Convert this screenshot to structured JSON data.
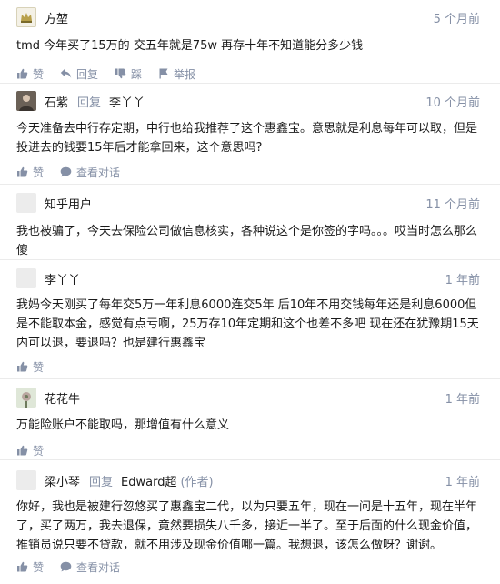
{
  "comments": [
    {
      "author": "方堃",
      "reply_word": "",
      "reply_target": "",
      "role": "",
      "time": "5 个月前",
      "text": "tmd 今年买了15万的 交五年就是75w 再存十年不知道能分多少钱",
      "actions": [
        "赞",
        "回复",
        "踩",
        "举报"
      ]
    },
    {
      "author": "石紫",
      "reply_word": "回复",
      "reply_target": "李丫丫",
      "role": "",
      "time": "10 个月前",
      "text": "今天准备去中行存定期，中行也给我推荐了这个惠鑫宝。意思就是利息每年可以取，但是投进去的钱要15年后才能拿回来，这个意思吗?",
      "actions": [
        "赞",
        "查看对话"
      ]
    },
    {
      "author": "知乎用户",
      "reply_word": "",
      "reply_target": "",
      "role": "",
      "time": "11 个月前",
      "text": "我也被骗了，今天去保险公司做信息核实，各种说这个是你签的字吗。。。哎当时怎么那么傻",
      "actions": []
    },
    {
      "author": "李丫丫",
      "reply_word": "",
      "reply_target": "",
      "role": "",
      "time": "1 年前",
      "text": "我妈今天刚买了每年交5万一年利息6000连交5年 后10年不用交钱每年还是利息6000但是不能取本金，感觉有点亏啊，25万存10年定期和这个也差不多吧  现在还在犹豫期15天内可以退，要退吗？也是建行惠鑫宝",
      "actions": [
        "赞"
      ]
    },
    {
      "author": "花花牛",
      "reply_word": "",
      "reply_target": "",
      "role": "",
      "time": "1 年前",
      "text": "万能险账户不能取吗，那增值有什么意义",
      "actions": [
        "赞"
      ]
    },
    {
      "author": "梁小琴",
      "reply_word": "回复",
      "reply_target": "Edward超",
      "role": "(作者)",
      "time": "1 年前",
      "text": "你好，我也是被建行忽悠买了惠鑫宝二代，以为只要五年，现在一问是十五年，现在半年了，买了两万，我去退保，竟然要损失八千多，接近一半了。至于后面的什么现金价值，推销员说只要不贷款，就不用涉及现金价值哪一篇。我想退，该怎么做呀？谢谢。",
      "actions": [
        "赞",
        "查看对话"
      ]
    }
  ]
}
